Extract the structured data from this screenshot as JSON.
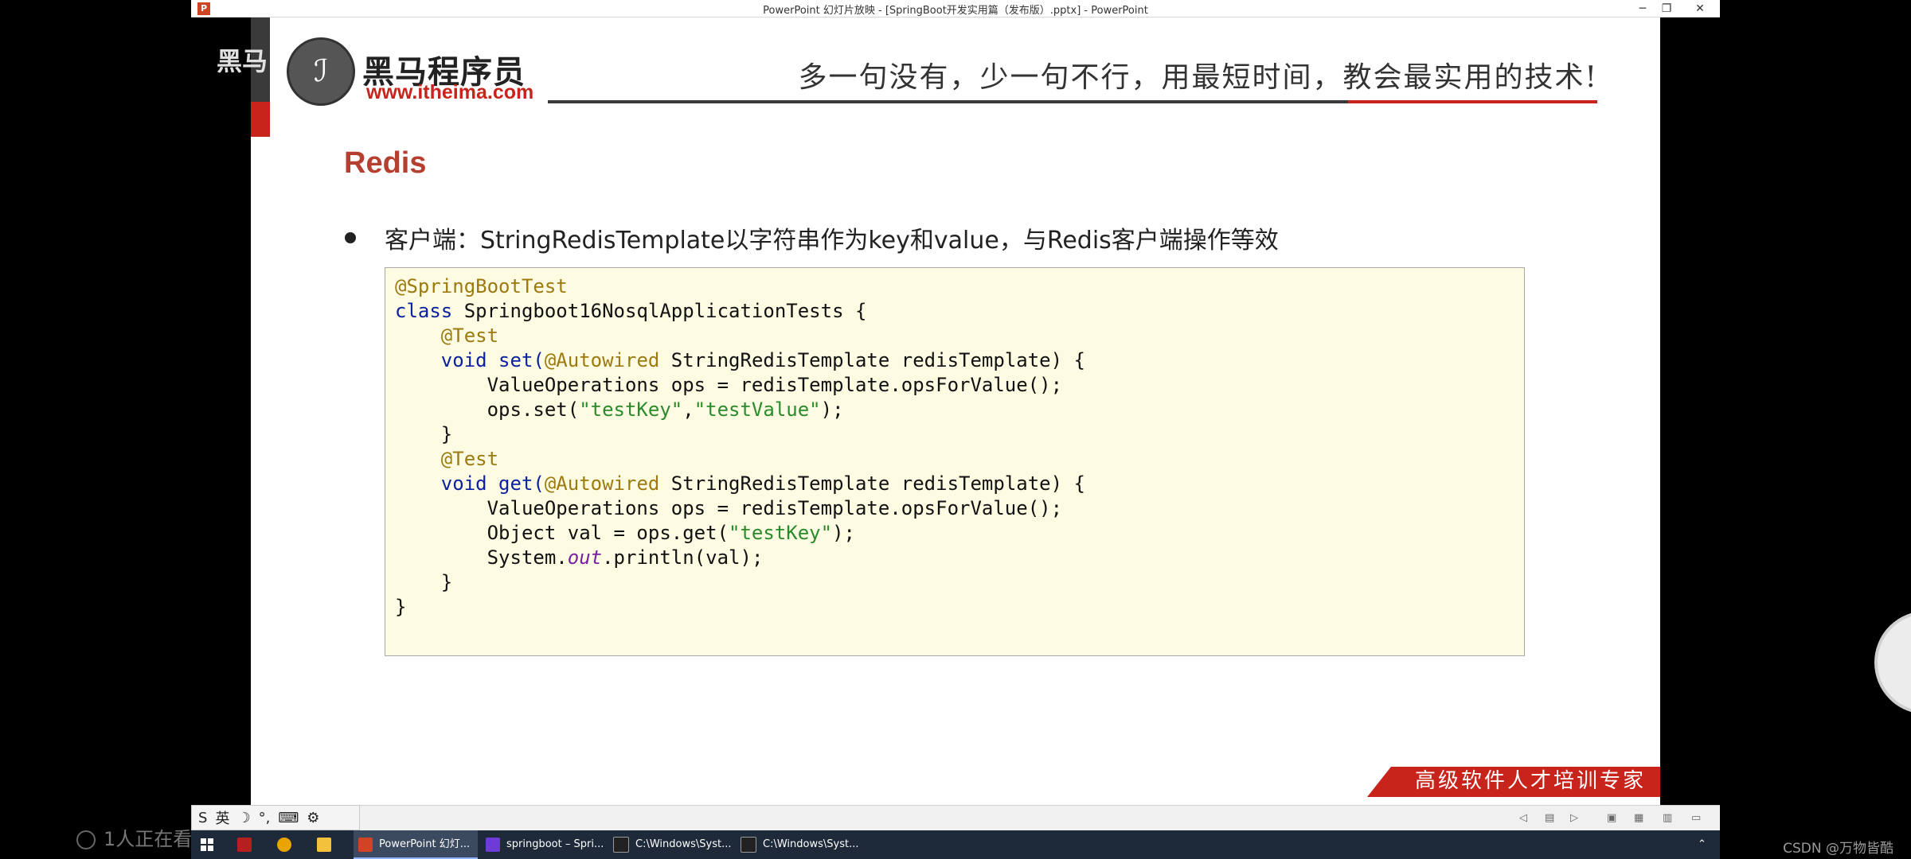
{
  "window": {
    "title": "PowerPoint 幻灯片放映 - [SpringBoot开发实用篇（发布版）.pptx] - PowerPoint",
    "app_icon_letter": "P",
    "minimize_glyph": "─",
    "restore_glyph": "❐",
    "close_glyph": "✕"
  },
  "slide": {
    "logo_mark": "ℐ",
    "logo_name": "黑马程序员",
    "logo_url": "www.itheima.com",
    "slogan": "多一句没有，少一句不行，用最短时间，教会最实用的技术!",
    "title": "Redis",
    "bullet": "客户端：StringRedisTemplate以字符串作为key和value，与Redis客户端操作等效",
    "footer": "高级软件人才培训专家",
    "colors": {
      "accent_red": "#c8241b",
      "title_red": "#b5402f",
      "code_bg": "#fdfce2"
    }
  },
  "code": {
    "l1_ann": "@SpringBootTest",
    "l2_kw": "class",
    "l2_rest": " Springboot16NosqlApplicationTests {",
    "l3_ann": "@Test",
    "l4_kw": "void",
    "l4_name": " set(",
    "l4_ann": "@Autowired",
    "l4_rest": " StringRedisTemplate redisTemplate) {",
    "l5": "ValueOperations ops = redisTemplate.opsForValue();",
    "l6_pre": "ops.set(",
    "l6_s1": "\"testKey\"",
    "l6_comma": ",",
    "l6_s2": "\"testValue\"",
    "l6_post": ");",
    "l7": "}",
    "l8_ann": "@Test",
    "l9_kw": "void",
    "l9_name": " get(",
    "l9_ann": "@Autowired",
    "l9_rest": " StringRedisTemplate redisTemplate) {",
    "l10": "ValueOperations ops = redisTemplate.opsForValue();",
    "l11_pre": "Object val = ops.get(",
    "l11_s": "\"testKey\"",
    "l11_post": ");",
    "l12_pre": "System.",
    "l12_field": "out",
    "l12_post": ".println(val);",
    "l13": "}",
    "l14": "}"
  },
  "overlay": {
    "watermark_top": "黑马",
    "viewers": "1人正在看",
    "csdn": "CSDN @万物皆酷"
  },
  "ime": {
    "logo": "S",
    "lang": "英",
    "moon": "☽",
    "punct": "°,",
    "keyboard": "⌨",
    "settings": "⚙"
  },
  "taskbar": {
    "items": [
      {
        "label": "PowerPoint 幻灯...",
        "color": "#d04423"
      },
      {
        "label": "springboot – Spri...",
        "color": "#6f3bd8"
      },
      {
        "label": "C:\\Windows\\Syst...",
        "color": "#222222"
      },
      {
        "label": "C:\\Windows\\Syst...",
        "color": "#222222"
      }
    ],
    "tray_chevron": "⌃"
  }
}
